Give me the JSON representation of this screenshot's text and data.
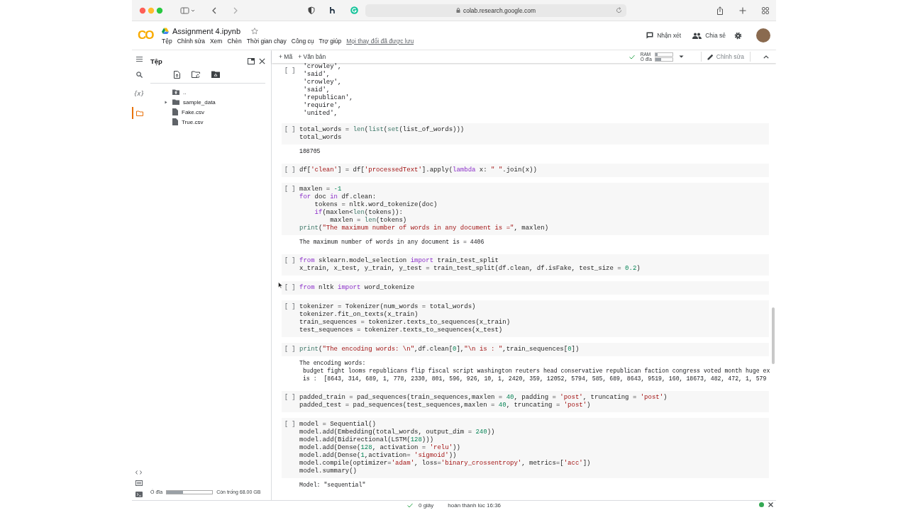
{
  "browser": {
    "url": "colab.research.google.com"
  },
  "header": {
    "logo": "CO",
    "title": "Assignment 4.ipynb",
    "starred": false,
    "menu": [
      "Tệp",
      "Chỉnh sửa",
      "Xem",
      "Chèn",
      "Thời gian chạy",
      "Công cụ",
      "Trợ giúp"
    ],
    "save_status": "Mọi thay đổi đã được lưu",
    "comment": "Nhận xét",
    "share": "Chia sẻ"
  },
  "toolbar": {
    "add_code": "+ Mã",
    "add_text": "+ Văn bản",
    "connected": true,
    "resources": [
      {
        "label": "RAM",
        "level": 0.12
      },
      {
        "label": "Ổ đĩa",
        "level": 0.35
      }
    ],
    "edit": "Chỉnh sửa"
  },
  "sidebar": {
    "rail": [
      {
        "kind": "search",
        "selected": false
      },
      {
        "kind": "variables",
        "label": "{x}",
        "selected": false
      },
      {
        "kind": "files",
        "selected": true
      }
    ],
    "title": "Tệp",
    "files": [
      {
        "kind": "parent",
        "name": ".."
      },
      {
        "kind": "folder",
        "name": "sample_data",
        "expanded": false
      },
      {
        "kind": "file",
        "name": "Fake.csv"
      },
      {
        "kind": "file",
        "name": "True.csv"
      }
    ],
    "disk": {
      "label": "Ổ đĩa",
      "level": 0.36,
      "free": "Còn trống 68.00 GB"
    }
  },
  "cells": [
    {
      "run_label": "[ ]",
      "output": [
        " 'crowley',",
        " 'said',",
        " 'crowley',",
        " 'said',",
        " 'republican',",
        " 'require',",
        " 'united',"
      ]
    },
    {
      "run_label": "[ ]",
      "code": [
        [
          {
            "kind": "plain",
            "text": "total_words = "
          },
          {
            "kind": "builtin",
            "text": "len"
          },
          {
            "kind": "plain",
            "text": "("
          },
          {
            "kind": "builtin",
            "text": "list"
          },
          {
            "kind": "plain",
            "text": "("
          },
          {
            "kind": "builtin",
            "text": "set"
          },
          {
            "kind": "plain",
            "text": "(list_of_words)))"
          }
        ],
        [
          {
            "kind": "plain",
            "text": "total_words"
          }
        ]
      ],
      "output": [
        "108705"
      ]
    },
    {
      "run_label": "[ ]",
      "code": [
        [
          {
            "kind": "plain",
            "text": "df["
          },
          {
            "kind": "string",
            "text": "'clean'"
          },
          {
            "kind": "plain",
            "text": "] = df["
          },
          {
            "kind": "string",
            "text": "'processedText'"
          },
          {
            "kind": "plain",
            "text": "].apply("
          },
          {
            "kind": "keyword",
            "text": "lambda"
          },
          {
            "kind": "plain",
            "text": " x: "
          },
          {
            "kind": "string",
            "text": "\" \""
          },
          {
            "kind": "plain",
            "text": ".join(x))"
          }
        ]
      ]
    },
    {
      "run_label": "[ ]",
      "code": [
        [
          {
            "kind": "plain",
            "text": "maxlen = "
          },
          {
            "kind": "number",
            "text": "-1"
          }
        ],
        [
          {
            "kind": "keyword",
            "text": "for"
          },
          {
            "kind": "plain",
            "text": " doc "
          },
          {
            "kind": "keyword",
            "text": "in"
          },
          {
            "kind": "plain",
            "text": " df.clean:"
          }
        ],
        [
          {
            "kind": "plain",
            "text": "    tokens = nltk.word_tokenize(doc)"
          }
        ],
        [
          {
            "kind": "keyword",
            "text": "    if"
          },
          {
            "kind": "plain",
            "text": "(maxlen<"
          },
          {
            "kind": "builtin",
            "text": "len"
          },
          {
            "kind": "plain",
            "text": "(tokens)):"
          }
        ],
        [
          {
            "kind": "plain",
            "text": "        maxlen = "
          },
          {
            "kind": "builtin",
            "text": "len"
          },
          {
            "kind": "plain",
            "text": "(tokens)"
          }
        ],
        [
          {
            "kind": "builtin",
            "text": "print"
          },
          {
            "kind": "plain",
            "text": "("
          },
          {
            "kind": "string",
            "text": "\"The maximum number of words in any document is =\""
          },
          {
            "kind": "plain",
            "text": ", maxlen)"
          }
        ]
      ],
      "output": [
        "The maximum number of words in any document is = 4406"
      ]
    },
    {
      "run_label": "[ ]",
      "code": [
        [
          {
            "kind": "keyword",
            "text": "from"
          },
          {
            "kind": "plain",
            "text": " sklearn.model_selection "
          },
          {
            "kind": "keyword",
            "text": "import"
          },
          {
            "kind": "plain",
            "text": " train_test_split"
          }
        ],
        [
          {
            "kind": "plain",
            "text": "x_train, x_test, y_train, y_test = train_test_split(df.clean, df.isFake, test_size = "
          },
          {
            "kind": "number",
            "text": "0.2"
          },
          {
            "kind": "plain",
            "text": ")"
          }
        ]
      ]
    },
    {
      "run_label": "[ ]",
      "code": [
        [
          {
            "kind": "keyword",
            "text": "from"
          },
          {
            "kind": "plain",
            "text": " nltk "
          },
          {
            "kind": "keyword",
            "text": "import"
          },
          {
            "kind": "plain",
            "text": " word_tokenize"
          }
        ]
      ]
    },
    {
      "run_label": "[ ]",
      "code": [
        [
          {
            "kind": "plain",
            "text": "tokenizer = Tokenizer(num_words = total_words)"
          }
        ],
        [
          {
            "kind": "plain",
            "text": "tokenizer.fit_on_texts(x_train)"
          }
        ],
        [
          {
            "kind": "plain",
            "text": "train_sequences = tokenizer.texts_to_sequences(x_train)"
          }
        ],
        [
          {
            "kind": "plain",
            "text": "test_sequences = tokenizer.texts_to_sequences(x_test)"
          }
        ]
      ]
    },
    {
      "run_label": "[ ]",
      "code": [
        [
          {
            "kind": "builtin",
            "text": "print"
          },
          {
            "kind": "plain",
            "text": "("
          },
          {
            "kind": "string",
            "text": "\"The encoding words: \\n\""
          },
          {
            "kind": "plain",
            "text": ",df.clean["
          },
          {
            "kind": "number",
            "text": "0"
          },
          {
            "kind": "plain",
            "text": "],"
          },
          {
            "kind": "string",
            "text": "\"\\n is : \""
          },
          {
            "kind": "plain",
            "text": ",train_sequences["
          },
          {
            "kind": "number",
            "text": "0"
          },
          {
            "kind": "plain",
            "text": "])"
          }
        ]
      ],
      "output": [
        "The encoding words:",
        " budget fight looms republicans flip fiscal script washington reuters head conservative republican faction congress voted month huge ex",
        " is :  [8643, 314, 689, 1, 778, 2330, 801, 596, 926, 10, 1, 2420, 359, 12052, 5794, 585, 689, 8643, 9519, 160, 18673, 482, 472, 1, 579"
      ]
    },
    {
      "run_label": "[ ]",
      "code": [
        [
          {
            "kind": "plain",
            "text": "padded_train = pad_sequences(train_sequences,maxlen = "
          },
          {
            "kind": "number",
            "text": "40"
          },
          {
            "kind": "plain",
            "text": ", padding = "
          },
          {
            "kind": "string",
            "text": "'post'"
          },
          {
            "kind": "plain",
            "text": ", truncating = "
          },
          {
            "kind": "string",
            "text": "'post'"
          },
          {
            "kind": "plain",
            "text": ")"
          }
        ],
        [
          {
            "kind": "plain",
            "text": "padded_test = pad_sequences(test_sequences,maxlen = "
          },
          {
            "kind": "number",
            "text": "40"
          },
          {
            "kind": "plain",
            "text": ", truncating = "
          },
          {
            "kind": "string",
            "text": "'post'"
          },
          {
            "kind": "plain",
            "text": ")"
          }
        ]
      ]
    },
    {
      "run_label": "[ ]",
      "code": [
        [
          {
            "kind": "plain",
            "text": "model = Sequential()"
          }
        ],
        [
          {
            "kind": "plain",
            "text": "model.add(Embedding(total_words, output_dim = "
          },
          {
            "kind": "number",
            "text": "240"
          },
          {
            "kind": "plain",
            "text": "))"
          }
        ],
        [
          {
            "kind": "plain",
            "text": "model.add(Bidirectional(LSTM("
          },
          {
            "kind": "number",
            "text": "128"
          },
          {
            "kind": "plain",
            "text": ")))"
          }
        ],
        [
          {
            "kind": "plain",
            "text": "model.add(Dense("
          },
          {
            "kind": "number",
            "text": "128"
          },
          {
            "kind": "plain",
            "text": ", activation = "
          },
          {
            "kind": "string",
            "text": "'relu'"
          },
          {
            "kind": "plain",
            "text": "))"
          }
        ],
        [
          {
            "kind": "plain",
            "text": "model.add(Dense("
          },
          {
            "kind": "number",
            "text": "1"
          },
          {
            "kind": "plain",
            "text": ",activation= "
          },
          {
            "kind": "string",
            "text": "'sigmoid'"
          },
          {
            "kind": "plain",
            "text": "))"
          }
        ],
        [
          {
            "kind": "plain",
            "text": "model.compile(optimizer="
          },
          {
            "kind": "string",
            "text": "'adam'"
          },
          {
            "kind": "plain",
            "text": ", loss="
          },
          {
            "kind": "string",
            "text": "'binary_crossentropy'"
          },
          {
            "kind": "plain",
            "text": ", metrics=["
          },
          {
            "kind": "string",
            "text": "'acc'"
          },
          {
            "kind": "plain",
            "text": "])"
          }
        ],
        [
          {
            "kind": "plain",
            "text": "model.summary()"
          }
        ]
      ],
      "output": [
        "Model: \"sequential\""
      ]
    }
  ],
  "status_bar": {
    "done": true,
    "duration": "0 giây",
    "finished": "hoàn thành lúc 16:36",
    "connected": true
  }
}
